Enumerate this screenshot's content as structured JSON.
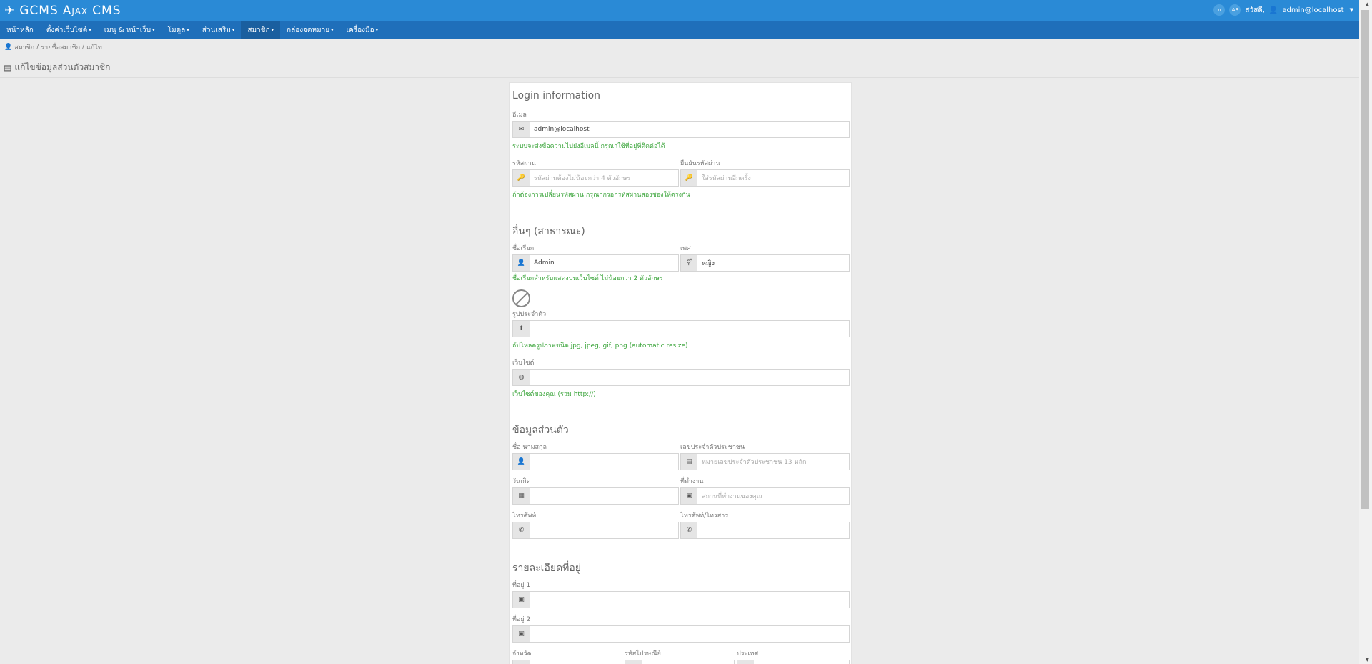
{
  "brand": {
    "name_prefix": "GCMS",
    "name_ajax": "Ajax",
    "name_suffix": "CMS"
  },
  "topbar": {
    "font_btn": "ก",
    "lang_btn": "AB",
    "greeting": "สวัสดี,",
    "user": "admin@localhost"
  },
  "nav": {
    "items": [
      {
        "label": "หน้าหลัก",
        "dropdown": false
      },
      {
        "label": "ตั้งค่าเว็บไซต์",
        "dropdown": true
      },
      {
        "label": "เมนู & หน้าเว็บ",
        "dropdown": true
      },
      {
        "label": "โมดูล",
        "dropdown": true
      },
      {
        "label": "ส่วนเสริม",
        "dropdown": true
      },
      {
        "label": "สมาชิก",
        "dropdown": true
      },
      {
        "label": "กล่องจดหมาย",
        "dropdown": true
      },
      {
        "label": "เครื่องมือ",
        "dropdown": true
      }
    ]
  },
  "breadcrumb": {
    "members": "สมาชิก",
    "list": "รายชื่อสมาชิก",
    "edit": "แก้ไข"
  },
  "page_title": "แก้ไขข้อมูลส่วนตัวสมาชิก",
  "form": {
    "login_title": "Login information",
    "email_label": "อีเมล",
    "email_value": "admin@localhost",
    "email_help": "ระบบจะส่งข้อความไปยังอีเมลนี้ กรุณาใช้ที่อยู่ที่ติดต่อได้",
    "password_label": "รหัสผ่าน",
    "password_placeholder": "รหัสผ่านต้องไม่น้อยกว่า 4 ตัวอักษร",
    "repassword_label": "ยืนยันรหัสผ่าน",
    "repassword_placeholder": "ใส่รหัสผ่านอีกครั้ง",
    "password_help": "ถ้าต้องการเปลี่ยนรหัสผ่าน กรุณากรอกรหัสผ่านสองช่องให้ตรงกัน",
    "public_title": "อื่นๆ (สาธารณะ)",
    "displayname_label": "ชื่อเรียก",
    "displayname_value": "Admin",
    "sex_label": "เพศ",
    "sex_value": "หญิง",
    "displayname_help": "ชื่อเรียกสำหรับแสดงบนเว็บไซต์ ไม่น้อยกว่า 2 ตัวอักษร",
    "avatar_label": "รูปประจำตัว",
    "avatar_help": "อัปโหลดรูปภาพชนิด jpg, jpeg, gif, png (automatic resize)",
    "website_label": "เว็บไซต์",
    "website_help": "เว็บไซต์ของคุณ (รวม http://)",
    "personal_title": "ข้อมูลส่วนตัว",
    "name_label": "ชื่อ นามสกุล",
    "idcard_label": "เลขประจำตัวประชาชน",
    "idcard_placeholder": "หมายเลขประจำตัวประชาชน 13 หลัก",
    "birthday_label": "วันเกิด",
    "company_label": "ที่ทำงาน",
    "company_placeholder": "สถานที่ทำงานของคุณ",
    "phone_label": "โทรศัพท์",
    "fax_label": "โทรศัพท์/โทรสาร",
    "address_title": "รายละเอียดที่อยู่",
    "address1_label": "ที่อยู่ 1",
    "address2_label": "ที่อยู่ 2",
    "province_label": "จังหวัด",
    "zipcode_label": "รหัสไปรษณีย์",
    "country_label": "ประเทศ"
  },
  "icons": {
    "plane": "✈",
    "user": "👤",
    "envelope": "✉",
    "key": "🔑",
    "sex": "⚥",
    "upload": "⬆",
    "globe": "◍",
    "card": "▤",
    "calendar": "▦",
    "building": "▣",
    "phone": "✆"
  },
  "colors": {
    "brand": "#2a8ad6",
    "nav": "#1f6fba",
    "help": "#3ba53b"
  }
}
